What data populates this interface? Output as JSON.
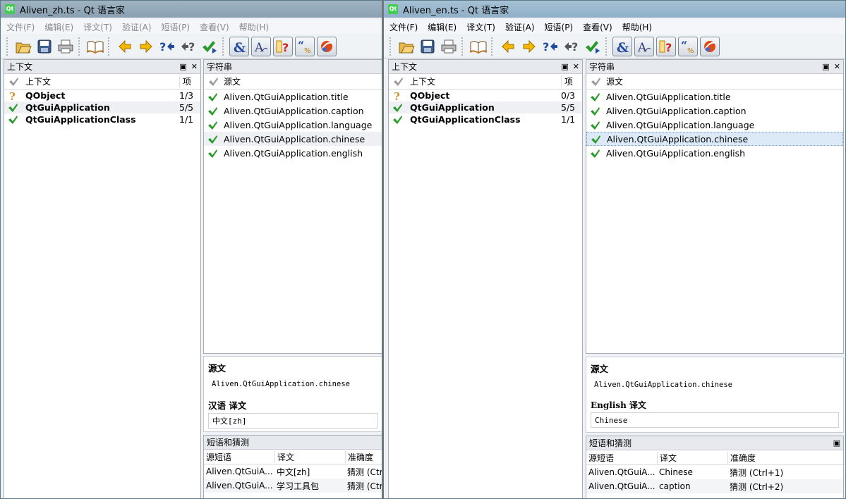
{
  "left": {
    "title": "Aliven_zh.ts - Qt 语言家",
    "menu": [
      "文件(F)",
      "编辑(E)",
      "译文(T)",
      "验证(A)",
      "短语(P)",
      "查看(V)",
      "帮助(H)"
    ],
    "context_pane": {
      "title": "上下文",
      "col_name": "上下文",
      "col_items": "项",
      "rows": [
        {
          "status": "question",
          "name": "QObject",
          "count": "1/3"
        },
        {
          "status": "check",
          "name": "QtGuiApplication",
          "count": "5/5"
        },
        {
          "status": "check",
          "name": "QtGuiApplicationClass",
          "count": "1/1"
        }
      ]
    },
    "strings_pane": {
      "title": "字符串",
      "col_source": "源文",
      "rows": [
        "Aliven.QtGuiApplication.title",
        "Aliven.QtGuiApplication.caption",
        "Aliven.QtGuiApplication.language",
        "Aliven.QtGuiApplication.chinese",
        "Aliven.QtGuiApplication.english"
      ]
    },
    "editor": {
      "source_label": "源文",
      "source_text": "Aliven.QtGuiApplication.chinese",
      "translation_label": "汉语 译文",
      "translation_value": "中文[zh]"
    },
    "phrases": {
      "title": "短语和猜测",
      "col_source": "源短语",
      "col_translation": "译文",
      "col_accuracy": "准确度",
      "rows": [
        {
          "source": "Aliven.QtGuiA...",
          "translation": "中文[zh]",
          "accuracy": "猜测 (Ctrl"
        },
        {
          "source": "Aliven.QtGuiA...",
          "translation": "学习工具包",
          "accuracy": "猜测 (Ctr"
        }
      ]
    }
  },
  "right": {
    "title": "Aliven_en.ts - Qt 语言家",
    "menu": [
      "文件(F)",
      "编辑(E)",
      "译文(T)",
      "验证(A)",
      "短语(P)",
      "查看(V)",
      "帮助(H)"
    ],
    "context_pane": {
      "title": "上下文",
      "col_name": "上下文",
      "col_items": "项",
      "rows": [
        {
          "status": "question",
          "name": "QObject",
          "count": "0/3"
        },
        {
          "status": "check",
          "name": "QtGuiApplication",
          "count": "5/5"
        },
        {
          "status": "check",
          "name": "QtGuiApplicationClass",
          "count": "1/1"
        }
      ]
    },
    "strings_pane": {
      "title": "字符串",
      "col_source": "源文",
      "rows": [
        "Aliven.QtGuiApplication.title",
        "Aliven.QtGuiApplication.caption",
        "Aliven.QtGuiApplication.language",
        "Aliven.QtGuiApplication.chinese",
        "Aliven.QtGuiApplication.english"
      ]
    },
    "editor": {
      "source_label": "源文",
      "source_text": "Aliven.QtGuiApplication.chinese",
      "translation_label": "English 译文",
      "translation_value": "Chinese"
    },
    "phrases": {
      "title": "短语和猜测",
      "col_source": "源短语",
      "col_translation": "译文",
      "col_accuracy": "准确度",
      "rows": [
        {
          "source": "Aliven.QtGuiA...",
          "translation": "Chinese",
          "accuracy": "猜测 (Ctrl+1)"
        },
        {
          "source": "Aliven.QtGuiA...",
          "translation": "caption",
          "accuracy": "猜测 (Ctrl+2)"
        }
      ]
    }
  },
  "icons": {
    "check": "check-icon",
    "question": "question-icon"
  },
  "colors": {
    "check_green": "#2a9a2a",
    "question_gold": "#c8962a",
    "titlebar": "#9fb8cc"
  }
}
